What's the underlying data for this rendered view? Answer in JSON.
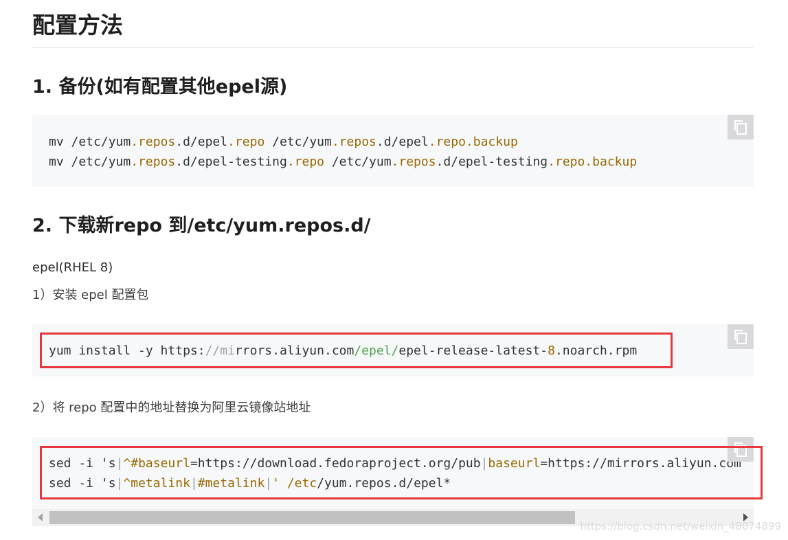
{
  "page": {
    "title": "配置方法",
    "section1": {
      "heading": "1. 备份(如有配置其他epel源)"
    },
    "section2": {
      "heading": "2. 下载新repo 到/etc/yum.repos.d/",
      "subheading": "epel(RHEL 8)",
      "step1": "1）安装 epel 配置包",
      "step2": "2）将 repo 配置中的地址替换为阿里云镜像站地址"
    }
  },
  "code": {
    "block1": {
      "line1": [
        "mv /etc/yum",
        ".repos",
        ".d/epel",
        ".repo",
        " /etc/yum",
        ".repos",
        ".d/epel",
        ".repo.backup"
      ],
      "line2": [
        "mv /etc/yum",
        ".repos",
        ".d/epel-testing",
        ".repo",
        " /etc/yum",
        ".repos",
        ".d/epel-testing",
        ".repo.backup"
      ]
    },
    "block2": {
      "line1": [
        "yum install -y https:",
        "//mi",
        "rrors.aliyun.com",
        "/epel/",
        "epel-release-latest-",
        "8",
        ".noarch.rpm"
      ]
    },
    "block3": {
      "line1": [
        "sed -i 's",
        "|",
        "^#baseurl",
        "=https://download.fedoraproject.org/pub",
        "|",
        "baseurl",
        "=https://mirrors.aliyun.com"
      ],
      "line2": [
        "sed -i 's",
        "|",
        "^metalink",
        "|",
        "#metalink",
        "|",
        "' /etc",
        "/yum.repos.d/epel*"
      ]
    }
  },
  "icons": {
    "copy": "copy-icon"
  },
  "colors": {
    "highlight_box": "#e8383d",
    "code_background": "#f6f8fa"
  },
  "watermark": "https://blog.csdn.net/weixin_48074899"
}
